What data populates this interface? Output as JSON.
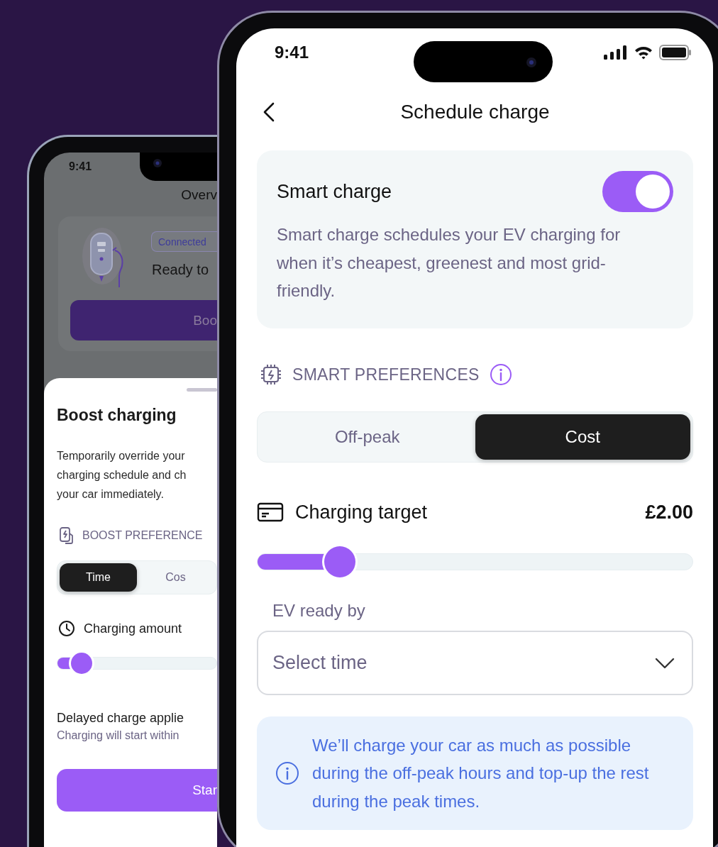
{
  "back_phone": {
    "status_time": "9:41",
    "screen_title": "Overv",
    "status_badge": "Connected",
    "status_text": "Ready to",
    "primary_button": "Boo",
    "sheet": {
      "title": "Boost charging",
      "description_lines": [
        "Temporarily override your",
        "charging schedule and ch",
        "your car immediately."
      ],
      "section_label": "BOOST PREFERENCE",
      "segments": [
        {
          "label": "Time",
          "selected": true
        },
        {
          "label": "Cos",
          "selected": false
        }
      ],
      "amount_label": "Charging amount",
      "amount_slider": {
        "level": 0.15
      },
      "notice_title": "Delayed charge applie",
      "notice_text": "Charging will start within",
      "start_button": "Star"
    }
  },
  "front_phone": {
    "status_time": "9:41",
    "title": "Schedule charge",
    "smart_charge": {
      "title": "Smart charge",
      "on": true,
      "description": "Smart charge schedules your EV charging for when it’s cheapest, greenest and most grid-friendly."
    },
    "preferences": {
      "label": "SMART PREFERENCES",
      "segments": [
        {
          "label": "Off-peak",
          "selected": false
        },
        {
          "label": "Cost",
          "selected": true
        }
      ]
    },
    "charging_target": {
      "label": "Charging target",
      "value": "£2.00",
      "level": 0.19
    },
    "ready_by": {
      "label": "EV ready by",
      "placeholder": "Select time"
    },
    "info": "We’ll charge your car as much as possible during the off-peak hours and top-up the rest during the peak times."
  }
}
